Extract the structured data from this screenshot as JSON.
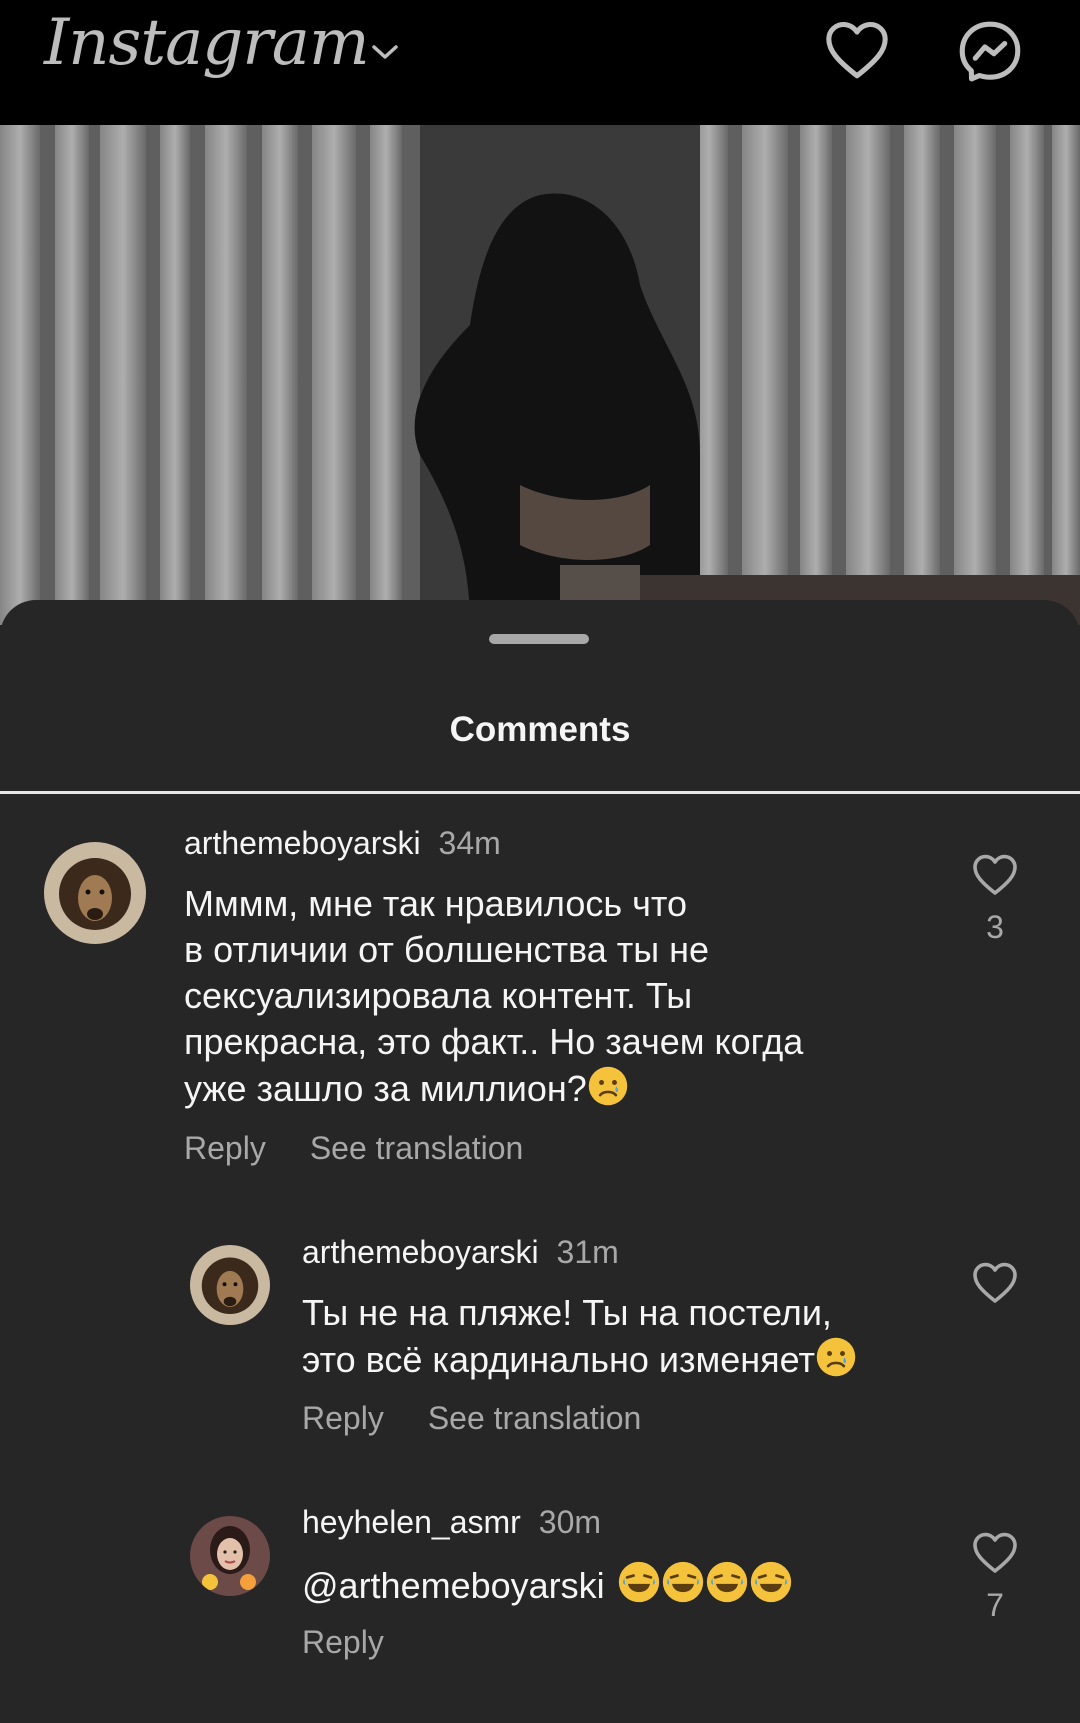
{
  "app": {
    "title": "Instagram"
  },
  "sheet": {
    "title": "Comments"
  },
  "comments": [
    {
      "username": "arthemeboyarski",
      "time": "34m",
      "lines": [
        "Мммм, мне так нравилось что",
        "в отличии от болшенства ты не",
        "сексуализировала контент. Ты",
        "прекрасна, это факт.. Но зачем когда",
        "уже зашло за миллион?"
      ],
      "reply_label": "Reply",
      "translate_label": "See translation",
      "likes": "3"
    },
    {
      "username": "arthemeboyarski",
      "time": "31m",
      "lines": [
        "Ты не на пляже! Ты на постели,",
        "это всё кардинально изменяет"
      ],
      "reply_label": "Reply",
      "translate_label": "See translation"
    },
    {
      "username": "heyhelen_asmr",
      "time": "30m",
      "lines": [
        "@arthemeboyarski"
      ],
      "reply_label": "Reply",
      "likes": "7"
    }
  ],
  "icons": {
    "heart": "heart-icon",
    "messenger": "messenger-icon",
    "chevron": "chevron-down-icon",
    "sad_emoji": "sad-face-emoji",
    "laugh_emoji": "laughing-face-emoji"
  },
  "colors": {
    "background": "#262626",
    "topbar": "#000000",
    "secondary_text": "#a8a8a8",
    "text": "#f5f5f5"
  }
}
